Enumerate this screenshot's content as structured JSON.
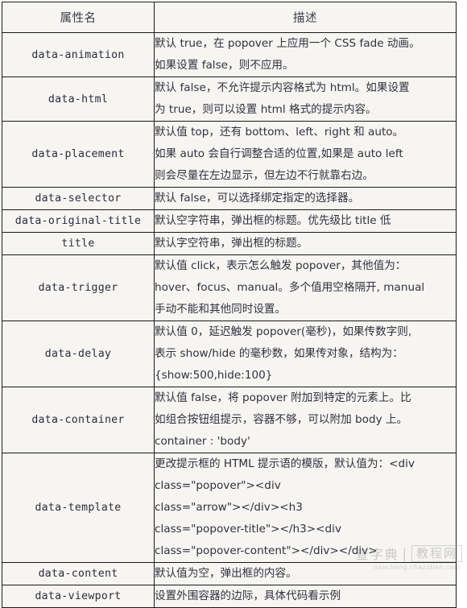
{
  "table": {
    "headers": [
      "属性名",
      "描述"
    ],
    "rows": [
      {
        "attr": "data-animation",
        "desc_lines": [
          "默认 true，在 popover 上应用一个 CSS fade 动画。",
          "如果设置 false，则不应用。"
        ]
      },
      {
        "attr": "data-html",
        "desc_lines": [
          "默认 false，不允许提示内容格式为 html。如果设置",
          "为 true，则可以设置 html 格式的提示内容。"
        ]
      },
      {
        "attr": "data-placement",
        "desc_lines": [
          "默认值 top，还有 bottom、left、right 和 auto。",
          "如果 auto 会自行调整合适的位置,如果是 auto left",
          "则会尽量在左边显示，但左边不行就靠右边。"
        ]
      },
      {
        "attr": "data-selector",
        "desc_lines": [
          "默认 false，可以选择绑定指定的选择器。"
        ]
      },
      {
        "attr": "data-original-title",
        "desc_lines": [
          "默认空字符串，弹出框的标题。优先级比 title 低"
        ]
      },
      {
        "attr": "title",
        "desc_lines": [
          "默认字空符串，弹出框的标题。"
        ]
      },
      {
        "attr": "data-trigger",
        "desc_lines": [
          "默认值 click，表示怎么触发 popover，其他值为：",
          "hover、focus、manual。多个值用空格隔开, manual",
          "手动不能和其他同时设置。"
        ]
      },
      {
        "attr": "data-delay",
        "desc_lines": [
          "默认值 0，延迟触发 popover(毫秒)，如果传数字则,",
          "表示 show/hide 的毫秒数，如果传对象，结构为：",
          "{show:500,hide:100}"
        ]
      },
      {
        "attr": "data-container",
        "desc_lines": [
          "默认值 false，将 popover 附加到特定的元素上。比",
          "如组合按钮组提示，容器不够，可以附加 body 上。",
          "container : 'body'"
        ]
      },
      {
        "attr": "data-template",
        "desc_lines": [
          "更改提示框的 HTML 提示语的模版，默认值为：<div",
          "class=\"popover\"><div",
          "class=\"arrow\"></div><h3",
          "class=\"popover-title\"></h3><div",
          "class=\"popover-content\"></div></div>"
        ]
      },
      {
        "attr": "data-content",
        "desc_lines": [
          "默认值为空，弹出框的内容。"
        ]
      },
      {
        "attr": "data-viewport",
        "desc_lines": [
          "设置外围容器的边际，具体代码看示例"
        ]
      }
    ]
  },
  "watermark": {
    "brand": "查字典",
    "separator": "|",
    "section": "教程网",
    "url": "jiaocheng.chazidian.com"
  },
  "colors": {
    "border": "#1a1a1a",
    "cell_background": "#f6f5f2",
    "text": "#31313f",
    "header_text": "#3a3a4a",
    "watermark_text": "#8a8a8a"
  }
}
